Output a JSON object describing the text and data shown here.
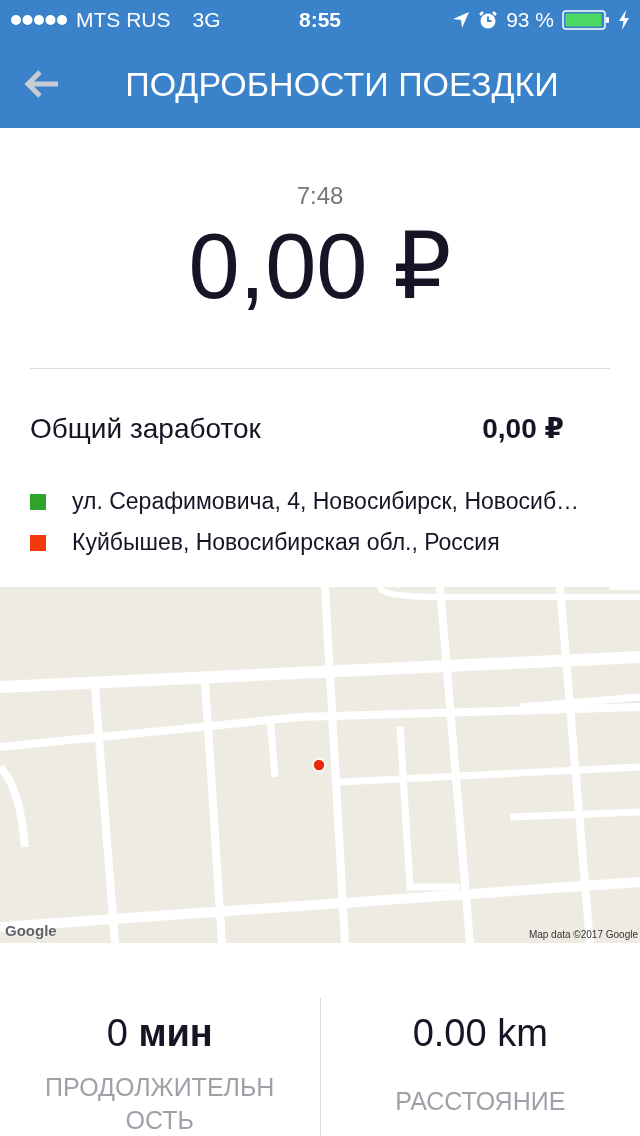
{
  "status_bar": {
    "carrier": "MTS RUS",
    "network": "3G",
    "time": "8:55",
    "battery": "93 %"
  },
  "nav": {
    "title": "ПОДРОБНОСТИ ПОЕЗДКИ"
  },
  "trip": {
    "time": "7:48",
    "total": "0,00 ₽"
  },
  "earnings": {
    "label": "Общий заработок",
    "value": "0,00 ₽"
  },
  "route": [
    {
      "color": "#2ea52a",
      "address": "ул. Серафимовича, 4, Новосибирск, Новосиб…"
    },
    {
      "color": "#f03a0a",
      "address": "Куйбышев, Новосибирская обл., Россия"
    }
  ],
  "map": {
    "kind": "picture",
    "logo": "Google",
    "attribution": "Map data ©2017 Google"
  },
  "stats": [
    {
      "value": "0 **мин**",
      "label": "ПРОДОЛЖИТЕЛЬНОСТЬ"
    },
    {
      "value": "0.00 km",
      "label": "РАССТОЯНИЕ"
    }
  ]
}
